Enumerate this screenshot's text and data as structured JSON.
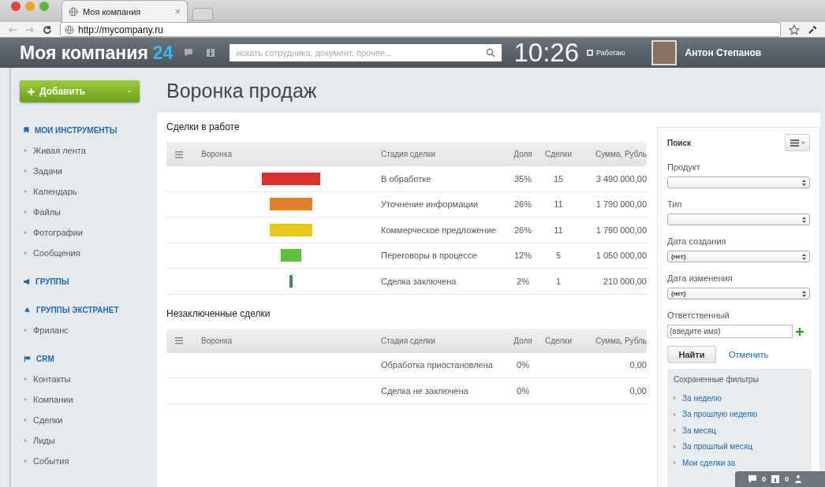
{
  "browser": {
    "tab_title": "Моя компания",
    "tab_close": "×",
    "url": "http://mycompany.ru"
  },
  "header": {
    "logo": "Моя компания",
    "logo_number": "24",
    "search_placeholder": "искать сотрудника, документ, прочее...",
    "time": "10:26",
    "status": "Работаю",
    "user": "Антон Степанов"
  },
  "add_button": "Добавить",
  "sidebar": [
    {
      "kind": "section",
      "label": "МОИ ИНСТРУМЕНТЫ"
    },
    {
      "kind": "item",
      "label": "Живая лента"
    },
    {
      "kind": "item",
      "label": "Задачи"
    },
    {
      "kind": "item",
      "label": "Календарь"
    },
    {
      "kind": "item",
      "label": "Файлы"
    },
    {
      "kind": "item",
      "label": "Фотографии"
    },
    {
      "kind": "item",
      "label": "Сообщения"
    },
    {
      "kind": "section",
      "label": "ГРУППЫ"
    },
    {
      "kind": "section",
      "label": "ГРУППЫ ЭКСТРАНЕТ"
    },
    {
      "kind": "item",
      "label": "Фриланс"
    },
    {
      "kind": "section",
      "label": "CRM"
    },
    {
      "kind": "item",
      "label": "Контакты"
    },
    {
      "kind": "item",
      "label": "Компании"
    },
    {
      "kind": "item",
      "label": "Сделки"
    },
    {
      "kind": "item",
      "label": "Лиды"
    },
    {
      "kind": "item",
      "label": "События"
    }
  ],
  "page_title": "Воронка продаж",
  "tables": [
    {
      "title": "Сделки в работе",
      "columns": [
        "Воронка",
        "Стадия сделки",
        "Доля",
        "Сделки",
        "Сумма, Рубль"
      ],
      "rows": [
        {
          "color": "#d93030",
          "stage": "В обработке",
          "share": "35%",
          "deals": "15",
          "sum": "3 490 000,00"
        },
        {
          "color": "#e08228",
          "stage": "Уточнение информации",
          "share": "26%",
          "deals": "11",
          "sum": "1 790 000,00"
        },
        {
          "color": "#e8c81e",
          "stage": "Коммерческое предложение",
          "share": "26%",
          "deals": "11",
          "sum": "1 790 000,00"
        },
        {
          "color": "#5cc43a",
          "stage": "Переговоры в процессе",
          "share": "12%",
          "deals": "5",
          "sum": "1 050 000,00"
        },
        {
          "color": "#3f8a62",
          "stage": "Сделка заключена",
          "share": "2%",
          "deals": "1",
          "sum": "210 000,00"
        }
      ]
    },
    {
      "title": "Незаключенные сделки",
      "columns": [
        "Воронка",
        "Стадия сделки",
        "Доля",
        "Сделки",
        "Сумма, Рубль"
      ],
      "rows": [
        {
          "stage": "Обработка приостановлена",
          "share": "0%",
          "sum": "0,00"
        },
        {
          "stage": "Сделка не заключена",
          "share": "0%",
          "sum": "0,00"
        }
      ]
    }
  ],
  "filter": {
    "title": "Поиск",
    "fields": [
      {
        "kind": "select",
        "label": "Продукт"
      },
      {
        "kind": "select",
        "label": "Тип"
      },
      {
        "kind": "select",
        "label": "Дата создания",
        "value": "(нет)"
      },
      {
        "kind": "select",
        "label": "Дата изменения",
        "value": "(нет)"
      },
      {
        "kind": "input",
        "label": "Ответственный",
        "value": "(введите имя)"
      }
    ],
    "find_button": "Найти",
    "cancel_link": "Отменить",
    "saved_title": "Сохраненные фильтры",
    "saved": [
      "За неделю",
      "За прошлую неделю",
      "За месяц",
      "За прошлый месяц",
      "Мои сделки за"
    ]
  },
  "bottom_bar": {
    "messages": "0",
    "notifications": "0"
  }
}
